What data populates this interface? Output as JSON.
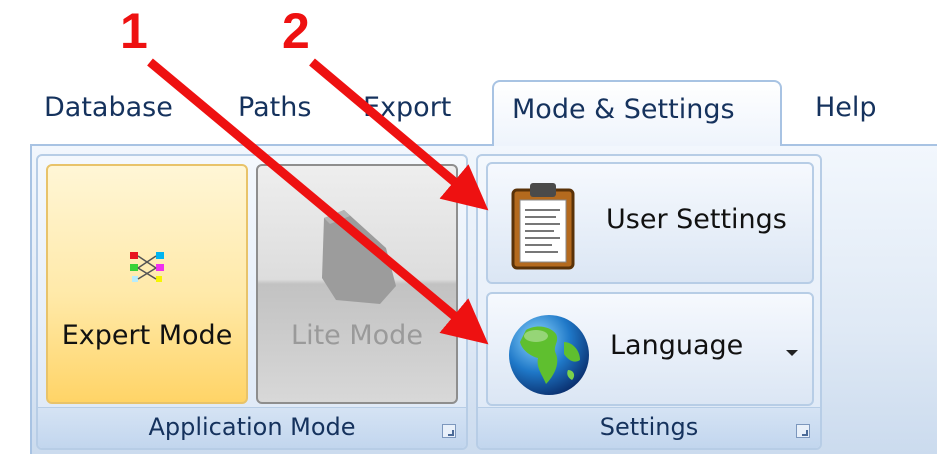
{
  "callouts": {
    "first": "1",
    "second": "2"
  },
  "tabs": [
    {
      "label": "Database",
      "active": false
    },
    {
      "label": "Paths",
      "active": false
    },
    {
      "label": "Export",
      "active": false
    },
    {
      "label": "Mode & Settings",
      "active": true
    },
    {
      "label": "Help",
      "active": false
    }
  ],
  "groups": {
    "application_mode": {
      "label": "Application Mode",
      "buttons": {
        "expert": {
          "label": "Expert Mode",
          "icon": "expert-mode-icon",
          "state": "selected"
        },
        "lite": {
          "label": "Lite Mode",
          "icon": "lite-mode-icon",
          "state": "disabled"
        }
      }
    },
    "settings": {
      "label": "Settings",
      "buttons": {
        "user_settings": {
          "label": "User Settings",
          "icon": "clipboard-icon"
        },
        "language": {
          "label": "Language",
          "icon": "globe-icon",
          "has_dropdown": true
        }
      }
    }
  },
  "colors": {
    "annotation": "#ee1111",
    "tab_text": "#15325d",
    "ribbon_border": "#a8c3e3",
    "selected_button": "#ffd467"
  }
}
